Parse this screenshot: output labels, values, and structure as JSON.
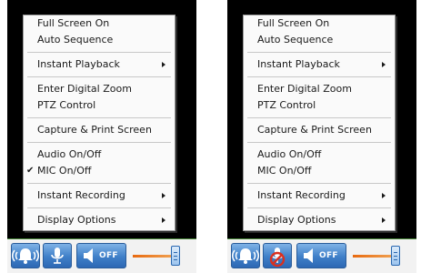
{
  "left_panel": {
    "menu": {
      "sections": [
        {
          "items": [
            {
              "label": "Full Screen On"
            },
            {
              "label": "Auto Sequence"
            }
          ]
        },
        {
          "items": [
            {
              "label": "Instant Playback",
              "submenu": true
            }
          ]
        },
        {
          "items": [
            {
              "label": "Enter Digital Zoom"
            },
            {
              "label": "PTZ Control"
            }
          ]
        },
        {
          "items": [
            {
              "label": "Capture & Print Screen"
            }
          ]
        },
        {
          "items": [
            {
              "label": "Audio On/Off"
            },
            {
              "label": "MIC On/Off",
              "checked": true,
              "check_glyph": "✔"
            }
          ]
        },
        {
          "items": [
            {
              "label": "Instant Recording",
              "submenu": true
            }
          ]
        },
        {
          "items": [
            {
              "label": "Display Options",
              "submenu": true
            }
          ]
        }
      ]
    },
    "toolbar": {
      "alarm_icon": "bell-icon",
      "mic_icon": "microphone-icon",
      "mic_state": "on",
      "speaker_icon": "speaker-icon",
      "speaker_label": "OFF",
      "volume_level": 0.8
    }
  },
  "right_panel": {
    "menu": {
      "sections": [
        {
          "items": [
            {
              "label": "Full Screen On"
            },
            {
              "label": "Auto Sequence"
            }
          ]
        },
        {
          "items": [
            {
              "label": "Instant Playback",
              "submenu": true
            }
          ]
        },
        {
          "items": [
            {
              "label": "Enter Digital Zoom"
            },
            {
              "label": "PTZ Control"
            }
          ]
        },
        {
          "items": [
            {
              "label": "Capture & Print Screen"
            }
          ]
        },
        {
          "items": [
            {
              "label": "Audio On/Off"
            },
            {
              "label": "MIC On/Off"
            }
          ]
        },
        {
          "items": [
            {
              "label": "Instant Recording",
              "submenu": true
            }
          ]
        },
        {
          "items": [
            {
              "label": "Display Options",
              "submenu": true
            }
          ]
        }
      ]
    },
    "toolbar": {
      "alarm_icon": "bell-icon",
      "mic_icon": "microphone-muted-icon",
      "mic_state": "muted",
      "speaker_icon": "speaker-icon",
      "speaker_label": "OFF",
      "volume_level": 0.8
    }
  },
  "colors": {
    "video_bg": "#000000",
    "menu_bg": "#fafafa",
    "button_blue": "#3f7fc8",
    "volume_orange": "#e86a10",
    "muted_red": "#d83020"
  }
}
